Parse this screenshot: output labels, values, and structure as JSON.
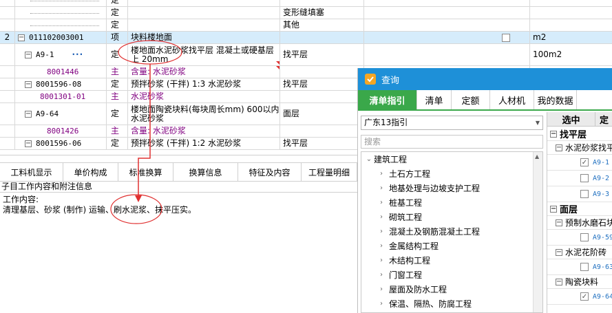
{
  "grid": {
    "rows": [
      {
        "num": "",
        "code": "",
        "type": "定",
        "name": "",
        "feature": "",
        "unit": ""
      },
      {
        "num": "",
        "code": "",
        "type": "定",
        "name": "",
        "feature": "变形缝填塞",
        "unit": ""
      },
      {
        "num": "",
        "code": "",
        "type": "定",
        "name": "",
        "feature": "其他",
        "unit": ""
      },
      {
        "num": "2",
        "code": "011102003001",
        "type": "项",
        "name": "块料楼地面",
        "feature": "",
        "unit": "m2"
      },
      {
        "num": "",
        "code": "A9-1",
        "type": "定",
        "name": "楼地面水泥砂浆找平层 混凝土或硬基层上 20mm",
        "feature": "找平层",
        "unit": "100m2"
      },
      {
        "num": "",
        "code": "8001446",
        "type": "主",
        "name": "含量: 水泥砂浆",
        "feature": "",
        "unit": ""
      },
      {
        "num": "",
        "code": "8001596-08",
        "type": "定",
        "name": "预拌砂浆 (干拌) 1:3 水泥砂浆",
        "feature": "找平层",
        "unit": ""
      },
      {
        "num": "",
        "code": "8001301-01",
        "type": "主",
        "name": "水泥砂浆",
        "feature": "",
        "unit": ""
      },
      {
        "num": "",
        "code": "A9-64",
        "type": "定",
        "name": "楼地面陶瓷块料(每块周长mm) 600以内 水泥砂浆",
        "feature": "面层",
        "unit": ""
      },
      {
        "num": "",
        "code": "8001426",
        "type": "主",
        "name": "含量: 水泥砂浆",
        "feature": "",
        "unit": ""
      },
      {
        "num": "",
        "code": "8001596-06",
        "type": "定",
        "name": "预拌砂浆 (干拌) 1:2 水泥砂浆",
        "feature": "找平层",
        "unit": ""
      }
    ],
    "more_dots": "···"
  },
  "bottom_tabs": [
    "工料机显示",
    "单价构成",
    "标准换算",
    "换算信息",
    "特征及内容",
    "工程量明细"
  ],
  "section_title": "子目工作内容和附注信息",
  "work_content": {
    "label": "工作内容:",
    "text_before": "清理基层、砂浆 (制作) 运输、",
    "highlight": "刷水泥浆",
    "text_after": "、抹平压实。"
  },
  "query_panel": {
    "title": "查询",
    "tabs": [
      "清单指引",
      "清单",
      "定额",
      "人材机",
      "我的数据"
    ],
    "region_select": "广东13指引",
    "search_placeholder": "搜索",
    "tree_root": "建筑工程",
    "tree_items": [
      "土石方工程",
      "地基处理与边坡支护工程",
      "桩基工程",
      "砌筑工程",
      "混凝土及钢筋混凝土工程",
      "金属结构工程",
      "木结构工程",
      "门窗工程",
      "屋面及防水工程",
      "保温、隔热、防腐工程"
    ],
    "result_headers": [
      "选中",
      "定"
    ],
    "result_rows": [
      {
        "kind": "group",
        "text": "找平层"
      },
      {
        "kind": "sub",
        "text": "水泥砂浆找平"
      },
      {
        "kind": "item",
        "code": "A9-1",
        "checked": true
      },
      {
        "kind": "item",
        "code": "A9-2",
        "checked": false
      },
      {
        "kind": "item",
        "code": "A9-3",
        "checked": false
      },
      {
        "kind": "group",
        "text": "面层"
      },
      {
        "kind": "sub",
        "text": "预制水磨石块"
      },
      {
        "kind": "item",
        "code": "A9-59",
        "checked": false
      },
      {
        "kind": "sub",
        "text": "水泥花阶砖"
      },
      {
        "kind": "item",
        "code": "A9-63",
        "checked": false
      },
      {
        "kind": "sub",
        "text": "陶瓷块料"
      },
      {
        "kind": "item",
        "code": "A9-64",
        "checked": true
      }
    ]
  },
  "colors": {
    "selected_row": "#d6ecfb",
    "main_material": "#800080",
    "panel_title": "#1e90d8",
    "active_tab": "#3aa84a",
    "annotation": "#e03030"
  }
}
